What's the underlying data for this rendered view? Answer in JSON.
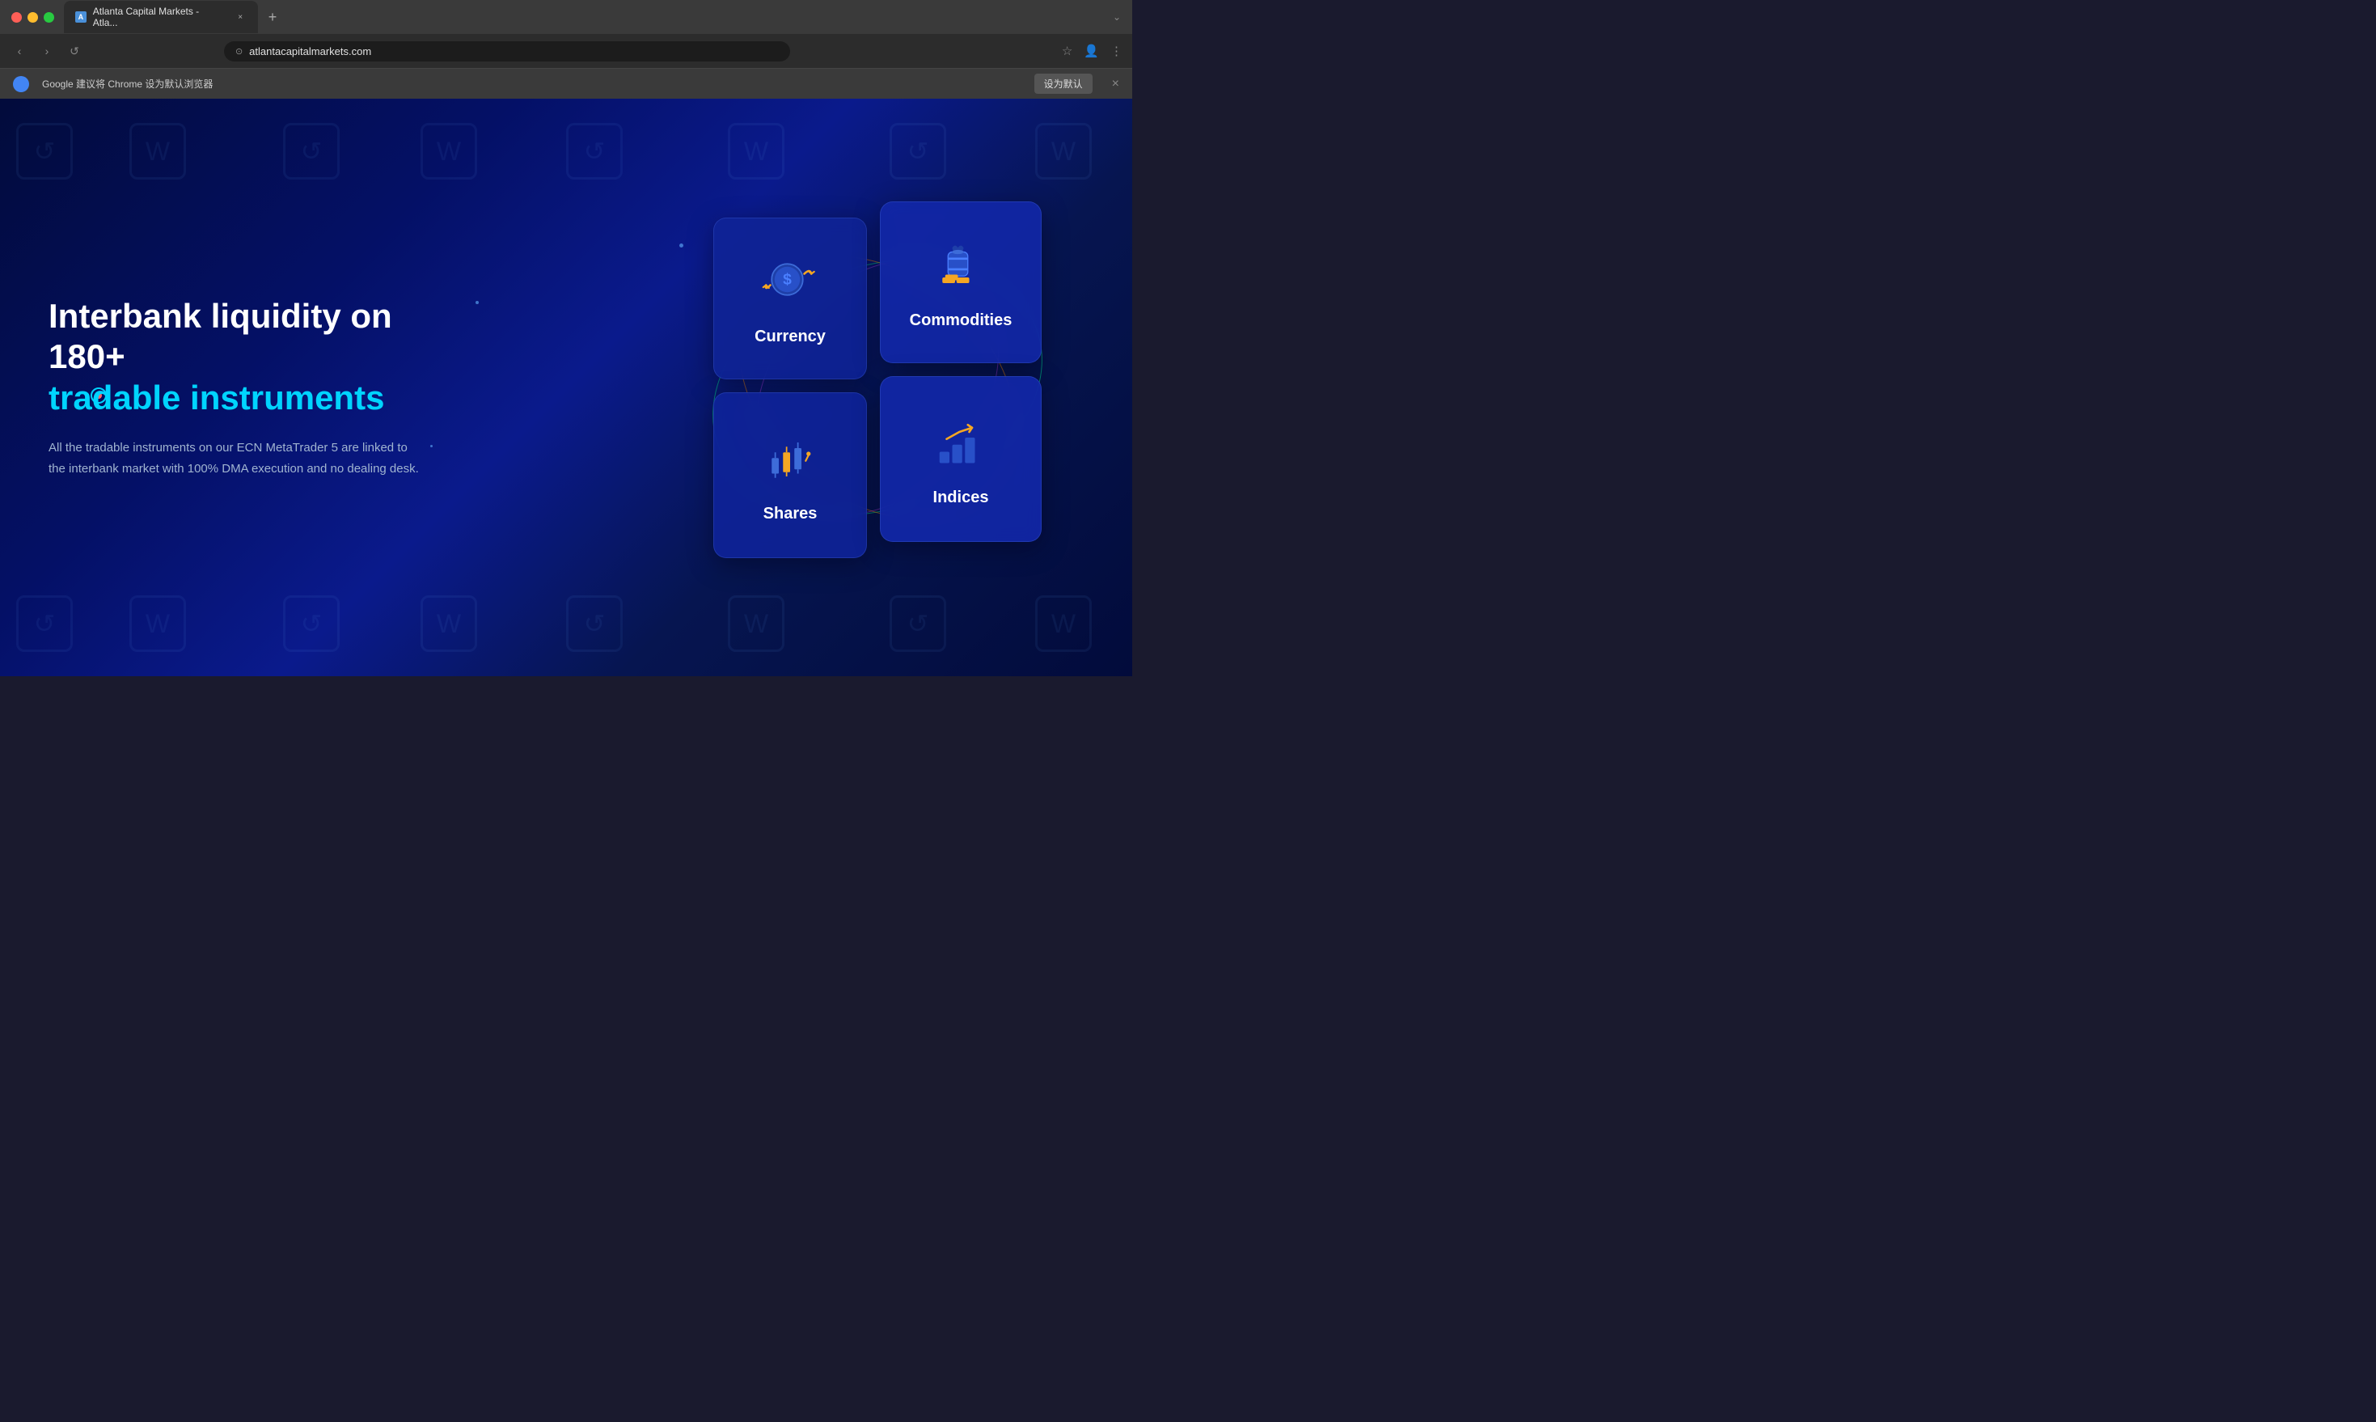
{
  "browser": {
    "traffic_lights": [
      "close",
      "minimize",
      "maximize"
    ],
    "tab": {
      "favicon_letter": "A",
      "title": "Atlanta Capital Markets - Atla...",
      "close_symbol": "×"
    },
    "new_tab_symbol": "+",
    "nav": {
      "back": "‹",
      "forward": "›",
      "refresh": "↺"
    },
    "address_bar": {
      "lock_icon": "⊙",
      "url": "atlantacapitalmarkets.com"
    },
    "toolbar_icons": {
      "bookmark": "☆",
      "profile": "👤",
      "menu": "⋮",
      "chevron": "⌄"
    },
    "chevron_label": "⌄"
  },
  "notification": {
    "text": "Google 建议将 Chrome 设为默认浏览器",
    "button_label": "设为默认",
    "close_symbol": "×"
  },
  "page": {
    "headline_line1": "Interbank liquidity on 180+",
    "headline_line2": "tradable instruments",
    "description": "All the tradable instruments on our ECN MetaTrader 5 are linked to the interbank market with 100% DMA execution and no dealing desk.",
    "cards": [
      {
        "id": "currency",
        "label": "Currency"
      },
      {
        "id": "commodities",
        "label": "Commodities"
      },
      {
        "id": "shares",
        "label": "Shares"
      },
      {
        "id": "indices",
        "label": "Indices"
      }
    ]
  }
}
